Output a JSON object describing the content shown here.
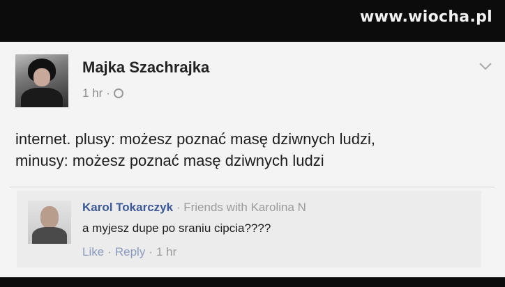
{
  "watermark": {
    "text": "www.wiocha.pl"
  },
  "post": {
    "author": "Majka Szachrajka",
    "time": "1 hr",
    "separator": "·",
    "privacy_icon": "globe-icon",
    "menu_icon": "chevron-down-icon",
    "text_line1": "internet. plusy: możesz poznać masę dziwnych ludzi,",
    "text_line2": "minusy: możesz poznać masę dziwnych ludzi"
  },
  "comment": {
    "author": "Karol Tokarczyk",
    "separator": "·",
    "relation": "Friends with Karolina N",
    "text": "a myjesz dupe po sraniu cipcia????",
    "like_label": "Like",
    "reply_label": "Reply",
    "time": "1 hr",
    "dot": "·"
  },
  "colors": {
    "link": "#3b5998",
    "background": "#f4f4f4",
    "frame": "#0c0c0c"
  }
}
